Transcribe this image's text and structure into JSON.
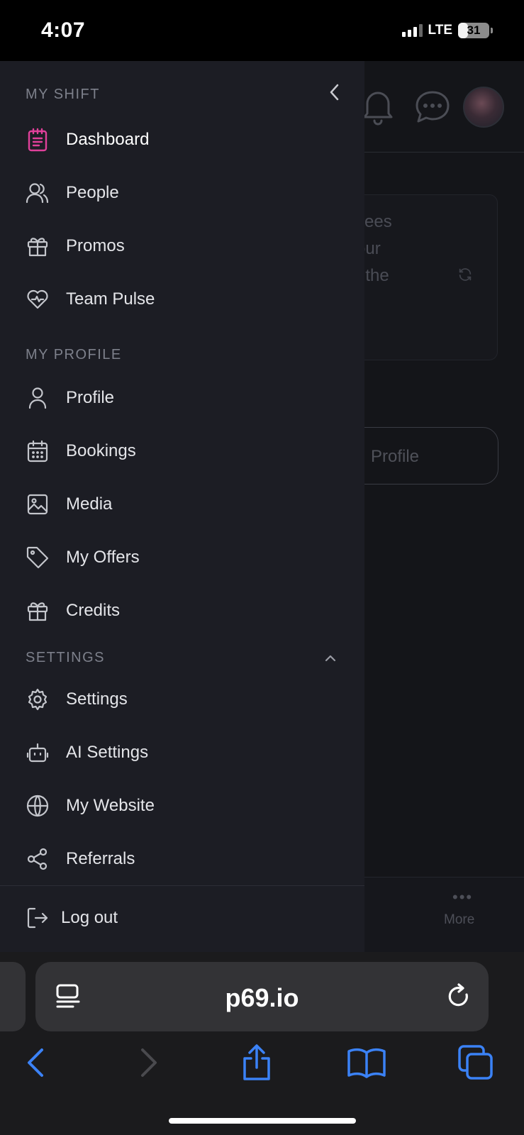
{
  "status_bar": {
    "time": "4:07",
    "network": "LTE",
    "battery": "31",
    "battery_level": 0.31
  },
  "background_page": {
    "card_text": "yees\nour\nf the",
    "profile_button": "Profile",
    "bottom_nav_more": "More",
    "more_dots": "•••"
  },
  "drawer": {
    "sections": {
      "my_shift": "MY SHIFT",
      "my_profile": "MY PROFILE",
      "settings": "SETTINGS"
    },
    "my_shift_items": [
      {
        "label": "Dashboard",
        "icon": "clipboard-icon",
        "active": true
      },
      {
        "label": "People",
        "icon": "users-icon"
      },
      {
        "label": "Promos",
        "icon": "gift-icon"
      },
      {
        "label": "Team Pulse",
        "icon": "heart-pulse-icon"
      }
    ],
    "my_profile_items": [
      {
        "label": "Profile",
        "icon": "user-icon"
      },
      {
        "label": "Bookings",
        "icon": "calendar-icon"
      },
      {
        "label": "Media",
        "icon": "image-icon"
      },
      {
        "label": "My Offers",
        "icon": "tag-icon"
      },
      {
        "label": "Credits",
        "icon": "gift-icon"
      }
    ],
    "settings_items": [
      {
        "label": "Settings",
        "icon": "gear-icon"
      },
      {
        "label": "AI Settings",
        "icon": "robot-icon"
      },
      {
        "label": "My Website",
        "icon": "globe-icon"
      },
      {
        "label": "Referrals",
        "icon": "share-icon"
      }
    ],
    "logout": "Log out"
  },
  "browser": {
    "url": "p69.io"
  },
  "colors": {
    "active_accent": "#e0409a",
    "drawer_bg": "#1c1d24",
    "ios_blue": "#3b82f6"
  }
}
